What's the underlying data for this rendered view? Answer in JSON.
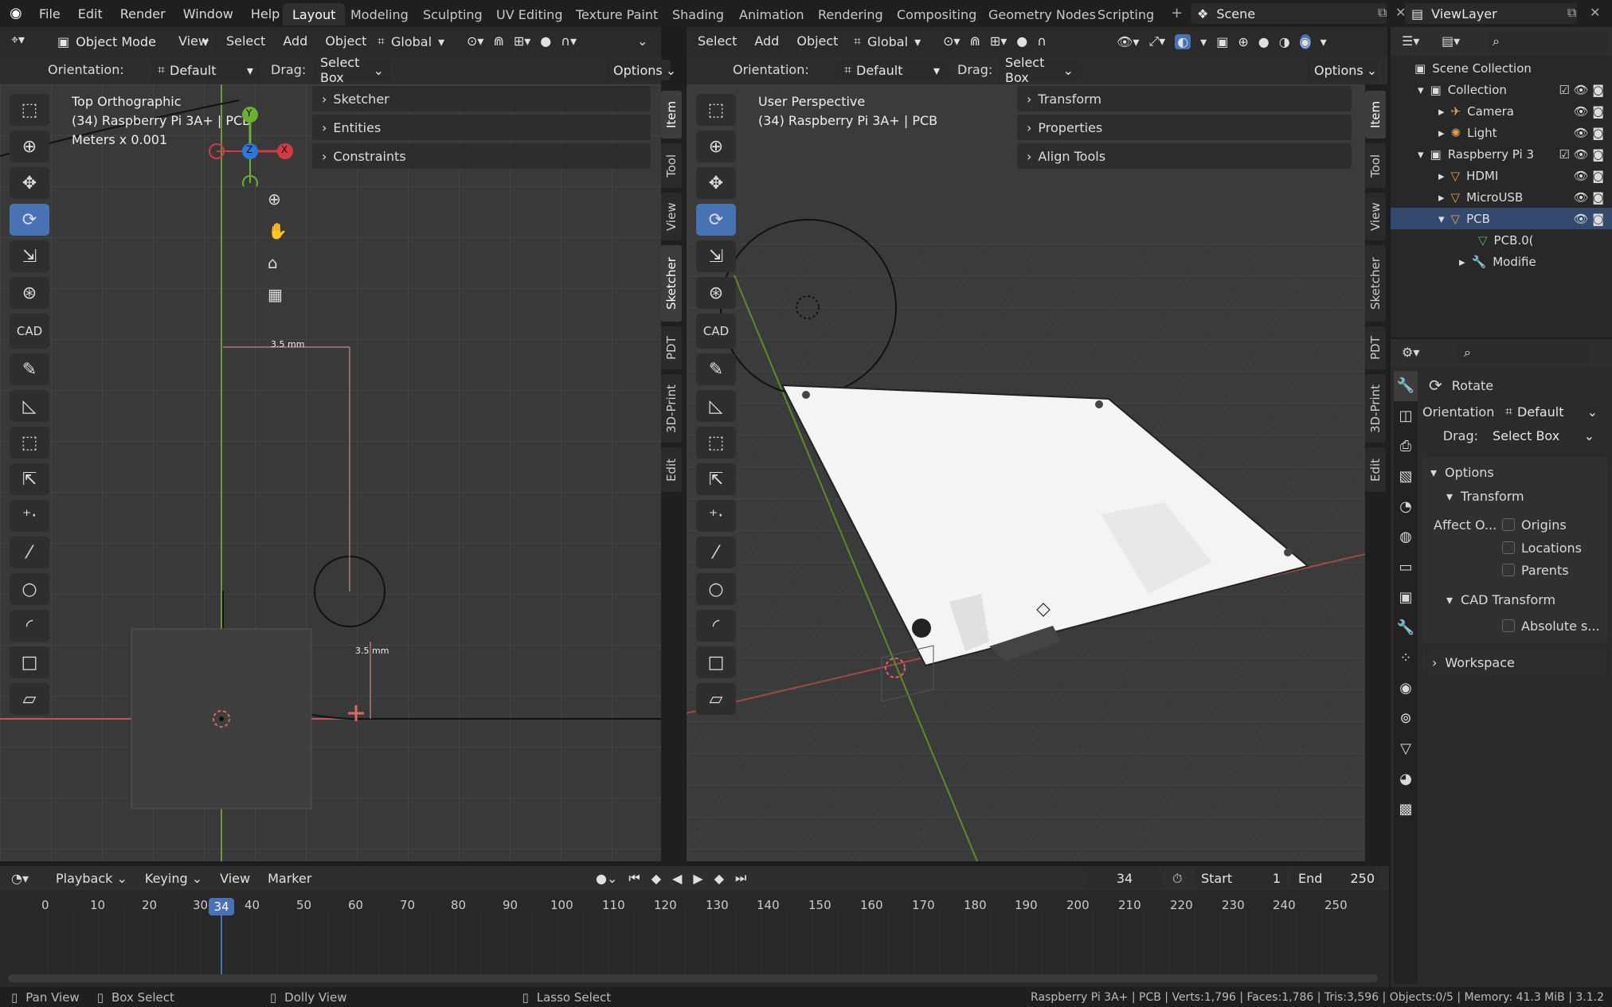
{
  "menu": [
    "File",
    "Edit",
    "Render",
    "Window",
    "Help"
  ],
  "workspaces": [
    "Layout",
    "Modeling",
    "Sculpting",
    "UV Editing",
    "Texture Paint",
    "Shading",
    "Animation",
    "Rendering",
    "Compositing",
    "Geometry Nodes",
    "Scripting"
  ],
  "scene_label": "Scene",
  "view_layer_label": "ViewLayer",
  "left_vp": {
    "mode": "Object Mode",
    "menus": [
      "View",
      "Select",
      "Add",
      "Object"
    ],
    "transform": "Global",
    "orientation_label": "Orientation:",
    "orientation_value": "Default",
    "drag_label": "Drag:",
    "drag_value": "Select Box",
    "options": "Options",
    "overlay_title": "Top Orthographic",
    "overlay_sub": "(34) Raspberry Pi 3A+ | PCB",
    "overlay_units": "Meters x 0.001",
    "gizmo": {
      "y": "Y",
      "x": "X",
      "z": "Z"
    },
    "panels": [
      "Sketcher",
      "Entities",
      "Constraints"
    ],
    "dim_top": "3.5 mm",
    "dim_right": "3.5 mm",
    "cad_label": "CAD"
  },
  "right_vp": {
    "menus": [
      "Select",
      "Add",
      "Object"
    ],
    "transform": "Global",
    "orientation_label": "Orientation:",
    "orientation_value": "Default",
    "drag_label": "Drag:",
    "drag_value": "Select Box",
    "options": "Options",
    "overlay_title": "User Perspective",
    "overlay_sub": "(34) Raspberry Pi 3A+ | PCB",
    "panels": [
      "Transform",
      "Properties",
      "Align Tools"
    ],
    "cad_label": "CAD"
  },
  "side_tabs": [
    "Item",
    "Tool",
    "View",
    "Sketcher",
    "PDT",
    "3D-Print",
    "Edit"
  ],
  "outliner": {
    "scene_collection": "Scene Collection",
    "items": [
      {
        "label": "Collection",
        "indent": 1
      },
      {
        "label": "Camera",
        "indent": 2
      },
      {
        "label": "Light",
        "indent": 2
      },
      {
        "label": "Raspberry Pi 3",
        "indent": 1
      },
      {
        "label": "HDMI",
        "indent": 2
      },
      {
        "label": "MicroUSB",
        "indent": 2
      },
      {
        "label": "PCB",
        "indent": 2
      },
      {
        "label": "PCB.0(",
        "indent": 3
      },
      {
        "label": "Modifie",
        "indent": 3
      }
    ]
  },
  "props": {
    "tool_name": "Rotate",
    "orientation_label": "Orientation",
    "orientation_value": "Default",
    "drag_label": "Drag:",
    "drag_value": "Select Box",
    "options": "Options",
    "transform": "Transform",
    "affect_label": "Affect O...",
    "affect_items": [
      "Origins",
      "Locations",
      "Parents"
    ],
    "cad_transform": "CAD Transform",
    "absolute": "Absolute s...",
    "workspace": "Workspace"
  },
  "timeline": {
    "menus": [
      "Playback",
      "Keying",
      "View",
      "Marker"
    ],
    "current_frame": "34",
    "start_label": "Start",
    "start_value": "1",
    "end_label": "End",
    "end_value": "250",
    "ticks": [
      "0",
      "10",
      "20",
      "30",
      "40",
      "50",
      "60",
      "70",
      "80",
      "90",
      "100",
      "110",
      "120",
      "130",
      "140",
      "150",
      "160",
      "170",
      "180",
      "190",
      "200",
      "210",
      "220",
      "230",
      "240",
      "250"
    ]
  },
  "status": {
    "pan": "Pan View",
    "box": "Box Select",
    "dolly": "Dolly View",
    "lasso": "Lasso Select",
    "info": "Raspberry Pi 3A+ | PCB | Verts:1,796 | Faces:1,786 | Tris:3,596 | Objects:0/5 | Memory: 41.3 MiB | 3.1.2"
  }
}
